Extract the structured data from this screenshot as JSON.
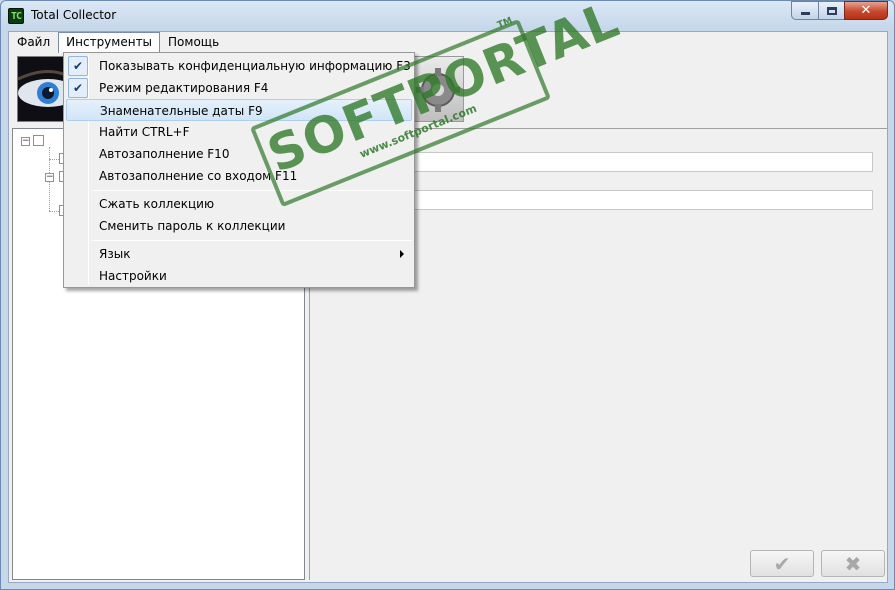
{
  "window": {
    "title": "Total Collector",
    "icon_text": "TC"
  },
  "menubar": {
    "items": [
      {
        "label": "Файл"
      },
      {
        "label": "Инструменты"
      },
      {
        "label": "Помощь"
      }
    ]
  },
  "dropdown": {
    "items": [
      {
        "label": "Показывать конфиденциальную информацию  F3",
        "checked": true
      },
      {
        "label": "Режим редактирования  F4",
        "checked": true
      },
      {
        "label": "Знаменательные даты  F9",
        "highlighted": true
      },
      {
        "label": "Найти  CTRL+F"
      },
      {
        "label": "Автозаполнение   F10"
      },
      {
        "label": "Автозаполнение со входом   F11"
      },
      {
        "label": "Сжать коллекцию"
      },
      {
        "label": "Сменить пароль к коллекции"
      },
      {
        "label": "Язык",
        "has_submenu": true
      },
      {
        "label": "Настройки"
      }
    ]
  },
  "buttons": {
    "ok_glyph": "✔",
    "cancel_glyph": "✖"
  },
  "watermark": {
    "brand": "SOFTPORTAL",
    "url": "www.softportal.com",
    "tm": "TM"
  },
  "colors": {
    "menu_highlight": "#d1e5f8",
    "watermark_green": "#2e7828"
  }
}
